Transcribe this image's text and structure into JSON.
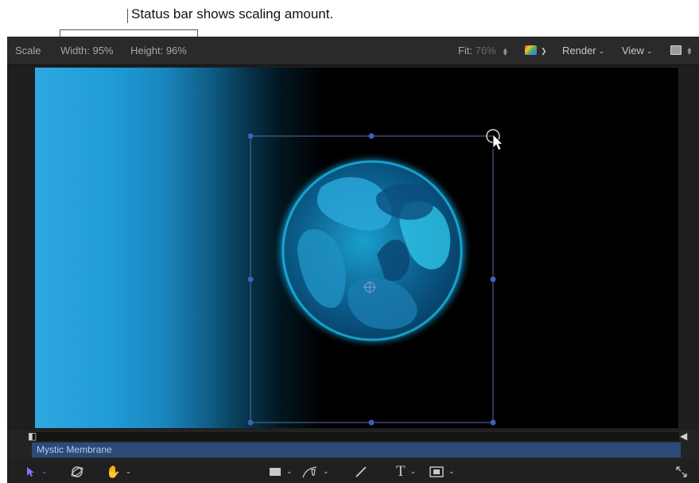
{
  "callout": {
    "text": "Status bar shows scaling amount."
  },
  "statusbar": {
    "tool_name": "Scale",
    "width_label": "Width:",
    "width_value": "95%",
    "height_label": "Height:",
    "height_value": "96%",
    "fit_label": "Fit:",
    "fit_value": "76%",
    "render_label": "Render",
    "view_label": "View"
  },
  "icons": {
    "color_channels": "color-swatch-icon",
    "view_layout": "view-layout-icon",
    "select_tool": "arrow-cursor-icon",
    "orbit_tool": "orbit-icon",
    "pan_tool": "hand-icon",
    "shape_tool": "rectangle-icon",
    "bezier_tool": "pen-icon",
    "paint_tool": "paintbrush-icon",
    "text_tool": "text-T-icon",
    "mask_tool": "mask-icon",
    "expand": "expand-arrows-icon"
  },
  "timeline": {
    "clip_name": "Mystic Membrane"
  },
  "colors": {
    "accent": "#8b6cf7",
    "handle": "#3f5fb8",
    "clip_bar": "#2b4a78",
    "background_blue": "#2fa8e0"
  }
}
